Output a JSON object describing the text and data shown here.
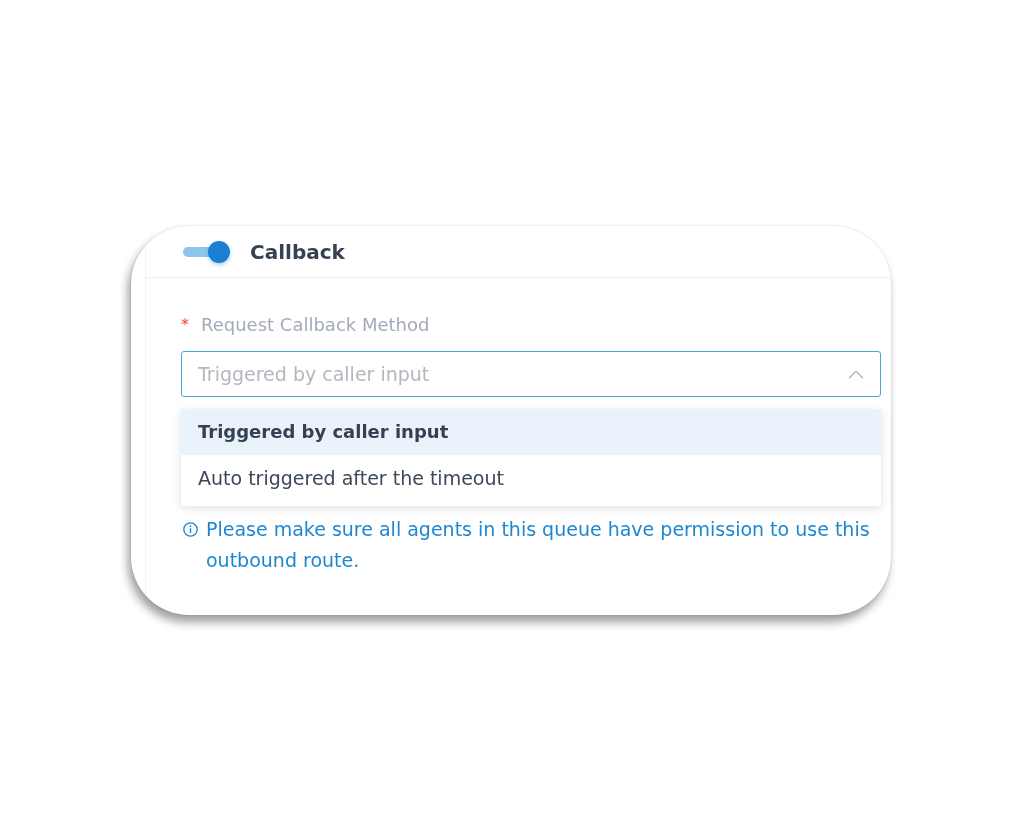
{
  "section": {
    "title": "Callback",
    "enabled": true
  },
  "field": {
    "required_mark": "*",
    "label": "Request Callback Method",
    "placeholder": "Triggered by caller input",
    "expanded": true
  },
  "options": [
    {
      "label": "Triggered by caller input",
      "selected": true
    },
    {
      "label": "Auto triggered after the timeout",
      "selected": false
    }
  ],
  "notice": "Please make sure all agents in this queue have permission to use this outbound route."
}
